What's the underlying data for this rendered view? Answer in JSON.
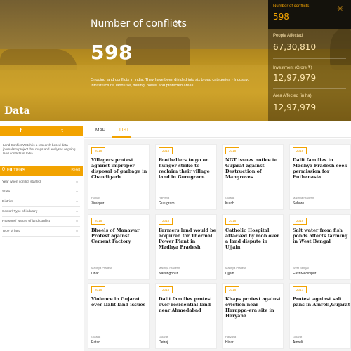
{
  "hero": {
    "title": "Number of conflicts",
    "count": "598",
    "description": "Ongoing land conflicts in India. They have been divided into six broad categories - Industry, Infrastructure, land use, mining, power and protected areas.",
    "data_label": "Data"
  },
  "stats": [
    {
      "label": "Number of conflicts",
      "value": "598"
    },
    {
      "label": "People Affected",
      "value": "67,30,810"
    },
    {
      "label": "Investment (Crore ₹)",
      "value": "12,97,979"
    },
    {
      "label": "Area Affected (in ha)",
      "value": "12,97,979"
    }
  ],
  "sidebar": {
    "social": [
      "f",
      "t"
    ],
    "about": "Land Conflict Watch is a research-based data journalism project that maps and analyses ongoing land conflicts in India.",
    "filters_title": "FILTERS",
    "filters_count": "0",
    "reset_label": "Reset",
    "filters": [
      "Year when conflict started",
      "State",
      "District",
      "Sector/ Type of industry",
      "Reasons/ Nature of land conflict",
      "Type of land"
    ]
  },
  "tabs": [
    "MAP",
    "LIST"
  ],
  "active_tab": "LIST",
  "cards": [
    {
      "year": "2018",
      "title": "Villagers protest against improper disposal of garbage in Chandigarh",
      "state": "Punjab",
      "district": "Zirakpur"
    },
    {
      "year": "2018",
      "title": "Footballers to go on hunger strike to reclaim their village land in Gurugram.",
      "state": "Haryana",
      "district": "Gurugram"
    },
    {
      "year": "2018",
      "title": "NGT issues notice to Gujarat against Destruction of Mangroves",
      "state": "Gujarat",
      "district": "Kutch"
    },
    {
      "year": "2018",
      "title": "Dalit families in Madhya Pradesh seek permission for Euthanasia",
      "state": "Madhya Pradesh",
      "district": "Sehore"
    },
    {
      "year": "2018",
      "title": "Bheels of Manawar Protest against Cement Factory",
      "state": "Madhya Pradesh",
      "district": "Dhar"
    },
    {
      "year": "2018",
      "title": "Farmers land would be acquired for Thermal Power Plant in Madhya Pradesh",
      "state": "Madhya Pradesh",
      "district": "Narsinghpur"
    },
    {
      "year": "2018",
      "title": "Catholic Hospital attacked by mob over a land dispute in Ujjain",
      "state": "Madhya Pradesh",
      "district": "Ujjain"
    },
    {
      "year": "2018",
      "title": "Salt water from fish ponds affects farming in West Bengal",
      "state": "West Bengal",
      "district": "East Medinipur"
    },
    {
      "year": "2018",
      "title": "Violence in Gujarat over Dalit land issues",
      "state": "Gujarat",
      "district": "Patan"
    },
    {
      "year": "2018",
      "title": "Dalit families protest over residential land near Ahmedabad",
      "state": "Gujarat",
      "district": "Detroj"
    },
    {
      "year": "2018",
      "title": "Khaps protest against eviction near Harappa-era site in Haryana",
      "state": "Haryana",
      "district": "Hisar"
    },
    {
      "year": "2017",
      "title": "Protest against salt pans in Amreli,Gujarat",
      "state": "Gujarat",
      "district": "Amreli"
    }
  ],
  "colors": {
    "accent": "#f2a300",
    "dark": "#14120c"
  },
  "icons": {
    "sun": "sun-icon",
    "facebook": "facebook-icon",
    "twitter": "twitter-icon",
    "chevron": "chevron-down-icon"
  }
}
